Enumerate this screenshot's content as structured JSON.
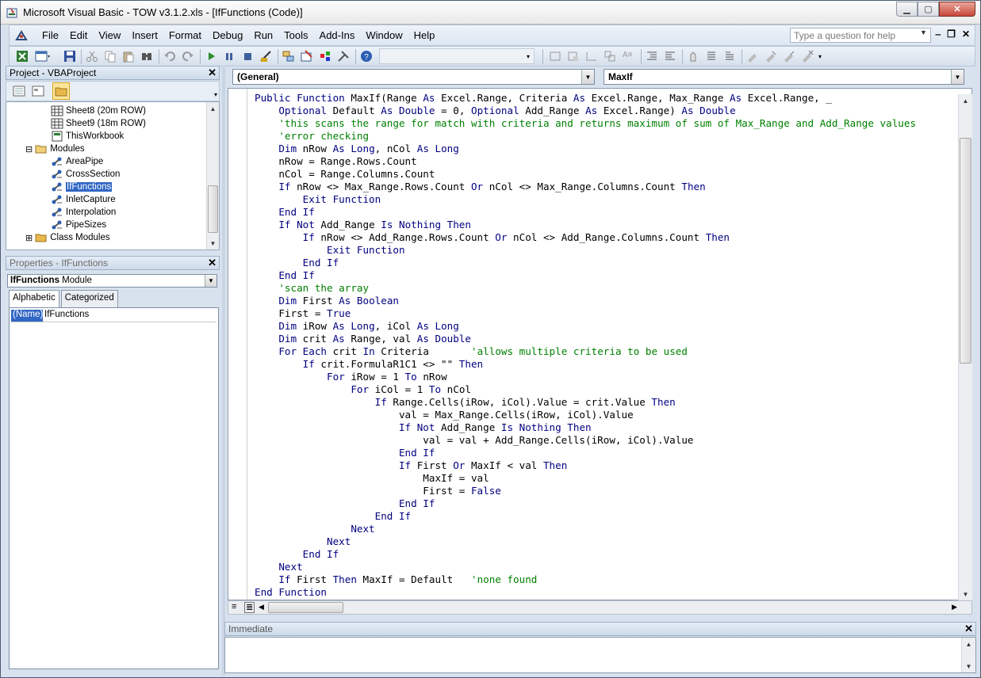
{
  "window": {
    "title": "Microsoft Visual Basic - TOW v3.1.2.xls - [IfFunctions (Code)]",
    "controls": {
      "minimize": "▁",
      "maximize": "▢",
      "close": "✕"
    }
  },
  "menubar": {
    "items": [
      "File",
      "Edit",
      "View",
      "Insert",
      "Format",
      "Debug",
      "Run",
      "Tools",
      "Add-Ins",
      "Window",
      "Help"
    ],
    "help_placeholder": "Type a question for help",
    "mdi_controls": [
      "‒",
      "❐",
      "✕"
    ]
  },
  "project_pane": {
    "title": "Project - VBAProject",
    "close": "✕",
    "tree": [
      {
        "label": "Sheet8 (20m ROW)",
        "icon": "sheet-icon",
        "indent": 2
      },
      {
        "label": "Sheet9 (18m ROW)",
        "icon": "sheet-icon",
        "indent": 2
      },
      {
        "label": "ThisWorkbook",
        "icon": "workbook-icon",
        "indent": 2
      },
      {
        "label": "Modules",
        "icon": "folder-open-icon",
        "indent": 1,
        "expander": "⊟"
      },
      {
        "label": "AreaPipe",
        "icon": "module-icon",
        "indent": 2
      },
      {
        "label": "CrossSection",
        "icon": "module-icon",
        "indent": 2
      },
      {
        "label": "IfFunctions",
        "icon": "module-icon",
        "indent": 2,
        "selected": true
      },
      {
        "label": "InletCapture",
        "icon": "module-icon",
        "indent": 2
      },
      {
        "label": "Interpolation",
        "icon": "module-icon",
        "indent": 2
      },
      {
        "label": "PipeSizes",
        "icon": "module-icon",
        "indent": 2
      },
      {
        "label": "Class Modules",
        "icon": "folder-closed-icon",
        "indent": 1,
        "expander": "⊞"
      }
    ]
  },
  "properties_pane": {
    "title": "Properties - IfFunctions",
    "close": "✕",
    "object_name": "IfFunctions",
    "object_type": "Module",
    "tabs": [
      "Alphabetic",
      "Categorized"
    ],
    "rows": [
      {
        "name": "(Name)",
        "value": "IfFunctions"
      }
    ]
  },
  "code_window": {
    "object_combo": "(General)",
    "procedure_combo": "MaxIf",
    "lines": [
      [
        [
          "kw",
          "Public Function "
        ],
        [
          "id",
          "MaxIf(Range "
        ],
        [
          "kw",
          "As "
        ],
        [
          "id",
          "Excel.Range, Criteria "
        ],
        [
          "kw",
          "As "
        ],
        [
          "id",
          "Excel.Range, Max_Range "
        ],
        [
          "kw",
          "As "
        ],
        [
          "id",
          "Excel.Range, _"
        ]
      ],
      [
        [
          "kw",
          "    Optional "
        ],
        [
          "id",
          "Default "
        ],
        [
          "kw",
          "As Double "
        ],
        [
          "id",
          "= 0, "
        ],
        [
          "kw",
          "Optional "
        ],
        [
          "id",
          "Add_Range "
        ],
        [
          "kw",
          "As "
        ],
        [
          "id",
          "Excel.Range) "
        ],
        [
          "kw",
          "As Double"
        ]
      ],
      [
        [
          "cm",
          "    'this scans the range for match with criteria and returns maximum of sum of Max_Range and Add_Range values"
        ]
      ],
      [
        [
          "cm",
          "    'error checking"
        ]
      ],
      [
        [
          "kw",
          "    Dim "
        ],
        [
          "id",
          "nRow "
        ],
        [
          "kw",
          "As Long"
        ],
        [
          "id",
          ", nCol "
        ],
        [
          "kw",
          "As Long"
        ]
      ],
      [
        [
          "id",
          "    nRow = Range.Rows.Count"
        ]
      ],
      [
        [
          "id",
          "    nCol = Range.Columns.Count"
        ]
      ],
      [
        [
          "kw",
          "    If "
        ],
        [
          "id",
          "nRow <> Max_Range.Rows.Count "
        ],
        [
          "kw",
          "Or "
        ],
        [
          "id",
          "nCol <> Max_Range.Columns.Count "
        ],
        [
          "kw",
          "Then"
        ]
      ],
      [
        [
          "kw",
          "        Exit Function"
        ]
      ],
      [
        [
          "kw",
          "    End If"
        ]
      ],
      [
        [
          "kw",
          "    If Not "
        ],
        [
          "id",
          "Add_Range "
        ],
        [
          "kw",
          "Is Nothing Then"
        ]
      ],
      [
        [
          "kw",
          "        If "
        ],
        [
          "id",
          "nRow <> Add_Range.Rows.Count "
        ],
        [
          "kw",
          "Or "
        ],
        [
          "id",
          "nCol <> Add_Range.Columns.Count "
        ],
        [
          "kw",
          "Then"
        ]
      ],
      [
        [
          "kw",
          "            Exit Function"
        ]
      ],
      [
        [
          "kw",
          "        End If"
        ]
      ],
      [
        [
          "kw",
          "    End If"
        ]
      ],
      [
        [
          "cm",
          "    'scan the array"
        ]
      ],
      [
        [
          "kw",
          "    Dim "
        ],
        [
          "id",
          "First "
        ],
        [
          "kw",
          "As Boolean"
        ]
      ],
      [
        [
          "id",
          "    First = "
        ],
        [
          "kw",
          "True"
        ]
      ],
      [
        [
          "kw",
          "    Dim "
        ],
        [
          "id",
          "iRow "
        ],
        [
          "kw",
          "As Long"
        ],
        [
          "id",
          ", iCol "
        ],
        [
          "kw",
          "As Long"
        ]
      ],
      [
        [
          "kw",
          "    Dim "
        ],
        [
          "id",
          "crit "
        ],
        [
          "kw",
          "As "
        ],
        [
          "id",
          "Range, val "
        ],
        [
          "kw",
          "As Double"
        ]
      ],
      [
        [
          "kw",
          "    For Each "
        ],
        [
          "id",
          "crit "
        ],
        [
          "kw",
          "In "
        ],
        [
          "id",
          "Criteria       "
        ],
        [
          "cm",
          "'allows multiple criteria to be used"
        ]
      ],
      [
        [
          "kw",
          "        If "
        ],
        [
          "id",
          "crit.FormulaR1C1 <> \"\" "
        ],
        [
          "kw",
          "Then"
        ]
      ],
      [
        [
          "kw",
          "            For "
        ],
        [
          "id",
          "iRow = 1 "
        ],
        [
          "kw",
          "To "
        ],
        [
          "id",
          "nRow"
        ]
      ],
      [
        [
          "kw",
          "                For "
        ],
        [
          "id",
          "iCol = 1 "
        ],
        [
          "kw",
          "To "
        ],
        [
          "id",
          "nCol"
        ]
      ],
      [
        [
          "kw",
          "                    If "
        ],
        [
          "id",
          "Range.Cells(iRow, iCol).Value = crit.Value "
        ],
        [
          "kw",
          "Then"
        ]
      ],
      [
        [
          "id",
          "                        val = Max_Range.Cells(iRow, iCol).Value"
        ]
      ],
      [
        [
          "kw",
          "                        If Not "
        ],
        [
          "id",
          "Add_Range "
        ],
        [
          "kw",
          "Is Nothing Then"
        ]
      ],
      [
        [
          "id",
          "                            val = val + Add_Range.Cells(iRow, iCol).Value"
        ]
      ],
      [
        [
          "kw",
          "                        End If"
        ]
      ],
      [
        [
          "kw",
          "                        If "
        ],
        [
          "id",
          "First "
        ],
        [
          "kw",
          "Or "
        ],
        [
          "id",
          "MaxIf < val "
        ],
        [
          "kw",
          "Then"
        ]
      ],
      [
        [
          "id",
          "                            MaxIf = val"
        ]
      ],
      [
        [
          "id",
          "                            First = "
        ],
        [
          "kw",
          "False"
        ]
      ],
      [
        [
          "kw",
          "                        End If"
        ]
      ],
      [
        [
          "kw",
          "                    End If"
        ]
      ],
      [
        [
          "kw",
          "                Next"
        ]
      ],
      [
        [
          "kw",
          "            Next"
        ]
      ],
      [
        [
          "kw",
          "        End If"
        ]
      ],
      [
        [
          "kw",
          "    Next"
        ]
      ],
      [
        [
          "kw",
          "    If "
        ],
        [
          "id",
          "First "
        ],
        [
          "kw",
          "Then "
        ],
        [
          "id",
          "MaxIf = Default   "
        ],
        [
          "cm",
          "'none found"
        ]
      ],
      [
        [
          "kw",
          "End Function"
        ]
      ]
    ]
  },
  "immediate_pane": {
    "title": "Immediate",
    "close": "✕"
  },
  "colors": {
    "keyword": "#000080",
    "comment": "#008000",
    "identifier": "#000000",
    "selection": "#3166c4"
  }
}
